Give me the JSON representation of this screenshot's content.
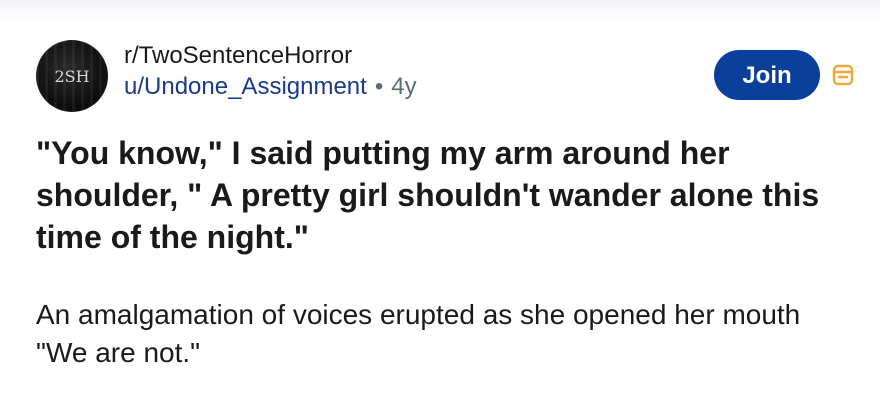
{
  "post": {
    "community_avatar_text": "2SH",
    "subreddit": "r/TwoSentenceHorror",
    "author": "u/Undone_Assignment",
    "separator": "•",
    "age": "4y",
    "join_label": "Join",
    "title": "\"You know,\" I said putting my arm around her shoulder, \" A pretty girl shouldn't wander alone this time of the night.\"",
    "body": "An amalgamation of voices erupted as she opened her mouth \"We are not.\""
  },
  "colors": {
    "join_button": "#0a3f9c",
    "author_link": "#1a3a8a",
    "save_icon": "#f2a93b",
    "text": "#1a1a1b"
  },
  "icons": {
    "avatar": "community-avatar-icon",
    "save": "save-icon"
  }
}
